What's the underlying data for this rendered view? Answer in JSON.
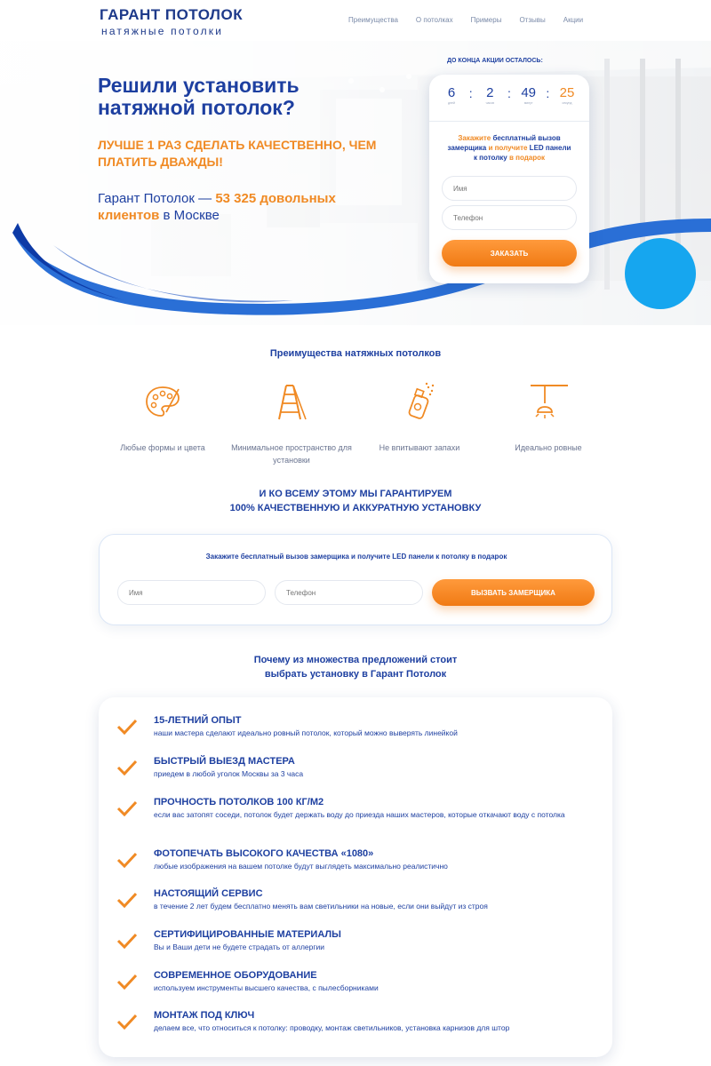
{
  "header": {
    "logo_main": "ГАРАНТ ПОТОЛОК",
    "logo_sub": "натяжные потолки",
    "nav": [
      "Преимущества",
      "О потолках",
      "Примеры",
      "Отзывы",
      "Акции"
    ]
  },
  "hero": {
    "title": "Решили установить натяжной потолок?",
    "subtitle": "ЛУЧШЕ 1 РАЗ СДЕЛАТЬ КАЧЕСТВЕННО, ЧЕМ ПЛАТИТЬ ДВАЖДЫ!",
    "clients_prefix": "Гарант Потолок — ",
    "clients_highlight": "53 325 довольных клиентов",
    "clients_suffix": " в Москве"
  },
  "timer": {
    "caption": "ДО КОНЦА АКЦИИ ОСТАЛОСЬ:",
    "cells": [
      {
        "value": "6",
        "label": "дней"
      },
      {
        "value": "2",
        "label": "часов"
      },
      {
        "value": "49",
        "label": "минут"
      },
      {
        "value": "25",
        "label": "секунд"
      }
    ]
  },
  "hero_form": {
    "text_1": "Закажите",
    "text_2": " бесплатный вызов замерщика ",
    "text_3": "и получите",
    "text_4": " LED панели к потолку ",
    "text_5": "в подарок",
    "name_placeholder": "Имя",
    "phone_placeholder": "Телефон",
    "button": "ЗАКАЗАТЬ"
  },
  "advantages": {
    "title": "Преимущества натяжных потолков",
    "items": [
      {
        "icon": "palette-icon",
        "label": "Любые формы и цвета"
      },
      {
        "icon": "ladder-icon",
        "label": "Минимальное пространство для установки"
      },
      {
        "icon": "spray-icon",
        "label": "Не впитывают запахи"
      },
      {
        "icon": "ceiling-lamp-icon",
        "label": "Идеально ровные"
      }
    ]
  },
  "guarantee": {
    "line_1": "И КО ВСЕМУ ЭТОМУ МЫ ГАРАНТИРУЕМ",
    "line_2": "100% КАЧЕСТВЕННУЮ И АККУРАТНУЮ УСТАНОВКУ"
  },
  "order_bar": {
    "text": "Закажите бесплатный вызов замерщика и получите LED панели к потолку в подарок",
    "name_placeholder": "Имя",
    "phone_placeholder": "Телефон",
    "button": "ВЫЗВАТЬ ЗАМЕРЩИКА"
  },
  "why": {
    "title_1": "Почему из множества предложений стоит",
    "title_2": "выбрать установку в Гарант Потолок",
    "items": [
      {
        "title": "15-ЛЕТНИЙ ОПЫТ",
        "desc": "наши мастера сделают идеально ровный потолок, который можно выверять линейкой"
      },
      {
        "title": "БЫСТРЫЙ ВЫЕЗД МАСТЕРА",
        "desc": "приедем в любой уголок Москвы за 3 часа"
      },
      {
        "title": "ПРОЧНОСТЬ ПОТОЛКОВ 100 КГ/М2",
        "desc": "если вас затопят соседи, потолок будет держать воду до приезда наших мастеров, которые откачают воду с потолка"
      },
      {
        "title": "ФОТОПЕЧАТЬ ВЫСОКОГО КАЧЕСТВА «1080»",
        "desc": "любые изображения на вашем потолке будут выглядеть максимально реалистично"
      },
      {
        "title": "НАСТОЯЩИЙ СЕРВИС",
        "desc": "в течение 2 лет будем бесплатно менять вам светильники на новые, если они выйдут из строя"
      },
      {
        "title": "СЕРТИФИЦИРОВАННЫЕ МАТЕРИАЛЫ",
        "desc": "Вы и Ваши дети не будете страдать от аллергии"
      },
      {
        "title": "СОВРЕМЕННОЕ ОБОРУДОВАНИЕ",
        "desc": "используем инструменты высшего качества, с пылесборниками"
      },
      {
        "title": "МОНТАЖ ПОД КЛЮЧ",
        "desc": "делаем все, что относиться к потолку: проводку, монтаж светильников, установка карнизов для штор"
      }
    ]
  },
  "colors": {
    "brand_blue": "#1d3fa0",
    "accent_orange": "#f08a24",
    "light_blue": "#16a6ef"
  }
}
